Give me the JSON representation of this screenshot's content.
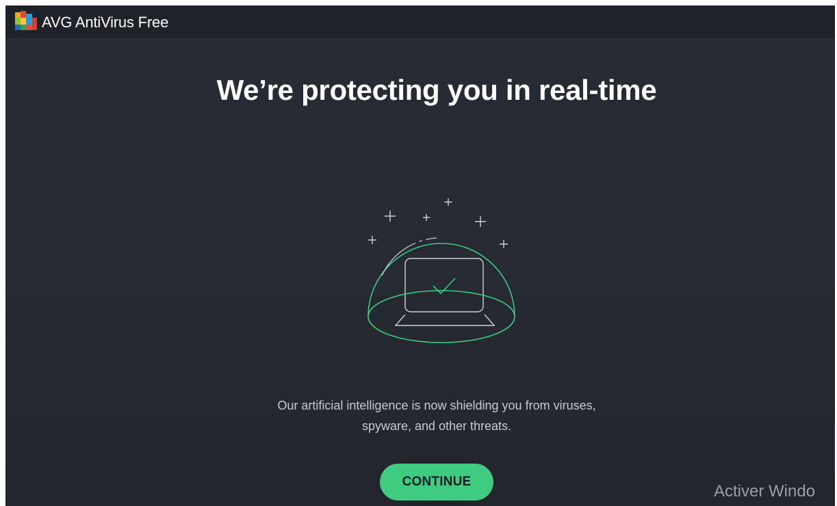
{
  "window": {
    "title": "AVG AntiVirus Free"
  },
  "main": {
    "headline": "We’re protecting you in real-time",
    "description_line1": "Our artificial intelligence is now shielding you from viruses,",
    "description_line2": "spyware, and other threats.",
    "continue_label": "CONTINUE"
  },
  "overlay": {
    "watermark": "Activer Windo"
  },
  "icons": {
    "logo": "avg-logo-icon",
    "illustration": "protected-laptop-dome-icon"
  },
  "colors": {
    "accent_green": "#3fcb80",
    "background": "#262a32",
    "titlebar": "#1f2228"
  }
}
